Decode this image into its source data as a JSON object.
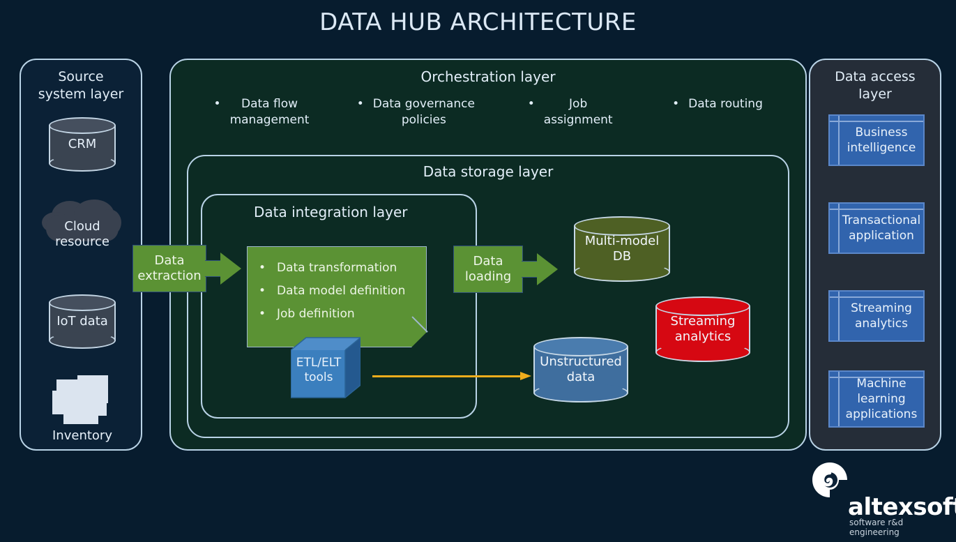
{
  "title": "DATA HUB ARCHITECTURE",
  "colors": {
    "background": "#071c2e",
    "layer_green": "#0c2b23",
    "accent_green": "#5b9234",
    "accent_blue": "#3164ad",
    "accent_red": "#d60812",
    "accent_olive": "#4e6024",
    "accent_steel": "#3f6e9e",
    "flow_arrow": "#f0ad1c",
    "border_light": "#b9d3e6",
    "text_light": "#e7f1fa"
  },
  "source_layer": {
    "title": "Source\nsystem layer",
    "items": [
      {
        "label": "CRM",
        "icon": "database-cylinder-icon"
      },
      {
        "label": "Cloud\nresource",
        "icon": "cloud-icon"
      },
      {
        "label": "IoT data",
        "icon": "database-cylinder-icon"
      },
      {
        "label": "Inventory",
        "icon": "inventory-boxes-icon"
      }
    ]
  },
  "orchestration_layer": {
    "title": "Orchestration layer",
    "bullets": [
      "Data flow\nmanagement",
      "Data governance\npolicies",
      "Job\nassignment",
      "Data routing"
    ],
    "bullet_glyph": "•"
  },
  "storage_layer": {
    "title": "Data storage layer"
  },
  "integration_layer": {
    "title": "Data integration layer",
    "card_items": [
      "Data transformation",
      "Data model definition",
      "Job definition"
    ],
    "bullet_glyph": "•",
    "cube_label": "ETL/ELT\ntools"
  },
  "flows": {
    "extraction_label": "Data\nextraction",
    "loading_label": "Data\nloading"
  },
  "stores": [
    {
      "label": "Multi-model\nDB",
      "color": "#4e6024"
    },
    {
      "label": "Streaming\nanalytics",
      "color": "#d60812"
    },
    {
      "label": "Unstructured\ndata",
      "color": "#3f6e9e"
    }
  ],
  "access_layer": {
    "title": "Data access\nlayer",
    "items": [
      "Business\nintelligence",
      "Transactional\napplication",
      "Streaming\nanalytics",
      "Machine\nlearning\napplications"
    ]
  },
  "logo": {
    "word": "altexsoft",
    "tagline": "software r&d engineering"
  }
}
